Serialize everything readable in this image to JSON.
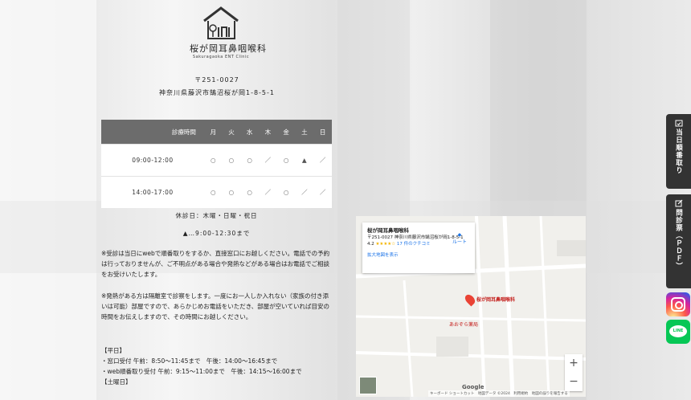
{
  "clinic": {
    "name": "桜が岡耳鼻咽喉科",
    "name_en": "Sakuragaoka ENT Clinic",
    "postal": "〒251-0027",
    "address": "神奈川県藤沢市鵠沼桜が岡1-8-5-1"
  },
  "schedule": {
    "header_label": "診療時間",
    "days": [
      "月",
      "火",
      "水",
      "木",
      "金",
      "土",
      "日"
    ],
    "rows": [
      {
        "time": "09:00-12:00",
        "marks": [
          "○",
          "○",
          "○",
          "／",
          "○",
          "▲",
          "／"
        ]
      },
      {
        "time": "14:00-17:00",
        "marks": [
          "○",
          "○",
          "○",
          "／",
          "○",
          "／",
          "／"
        ]
      }
    ]
  },
  "notes": {
    "closed": "休診日：木曜・日曜・祝日",
    "triangle": "▲…9:00-12:30まで",
    "p1": "※受診は当日にwebで順番取りをするか、直接窓口にお越しください。電話での予約は行っておりませんが、ご不明点がある場合や発熱などがある場合はお電話でご相談をお受けいたします。",
    "p2": "※発熱がある方は隔離室で診察をします。一度にお一人しか入れない（家族の付き添いは可能）部屋ですので、あらかじめお電話をいただき、部屋が空いていれば目安の時間をお伝えしますので、その時間にお越しください。",
    "weekday_heading": "【平日】",
    "weekday_line1": "・窓口受付 午前：8:50～11:45まで　午後：14:00～16:45まで",
    "weekday_line2": "・web順番取り受付 午前：9:15～11:00まで　午後：14:15～16:00まで",
    "saturday_heading": "【土曜日】"
  },
  "map": {
    "card_title": "桜が岡耳鼻咽喉科",
    "card_address": "〒251-0027 神奈川県藤沢市鵠沼桜が岡1-8-5-1",
    "card_rating": "4.2",
    "card_stars": "★★★★☆",
    "card_reviews": "17 件のクチコミ",
    "card_route": "ルート",
    "card_link": "拡大地図を表示",
    "pin_label": "桜が岡耳鼻咽喉科",
    "place_label_2": "あおぞら薬局",
    "zoom_in": "+",
    "zoom_out": "−",
    "footer": "キーボード ショートカット　地図データ ©2024　利用規約　地図の誤りを報告する",
    "google": "Google"
  },
  "side": {
    "btn1": "当日順番取り",
    "btn2": "問診票（ＰＤＦ）",
    "line_label": "LINE"
  }
}
